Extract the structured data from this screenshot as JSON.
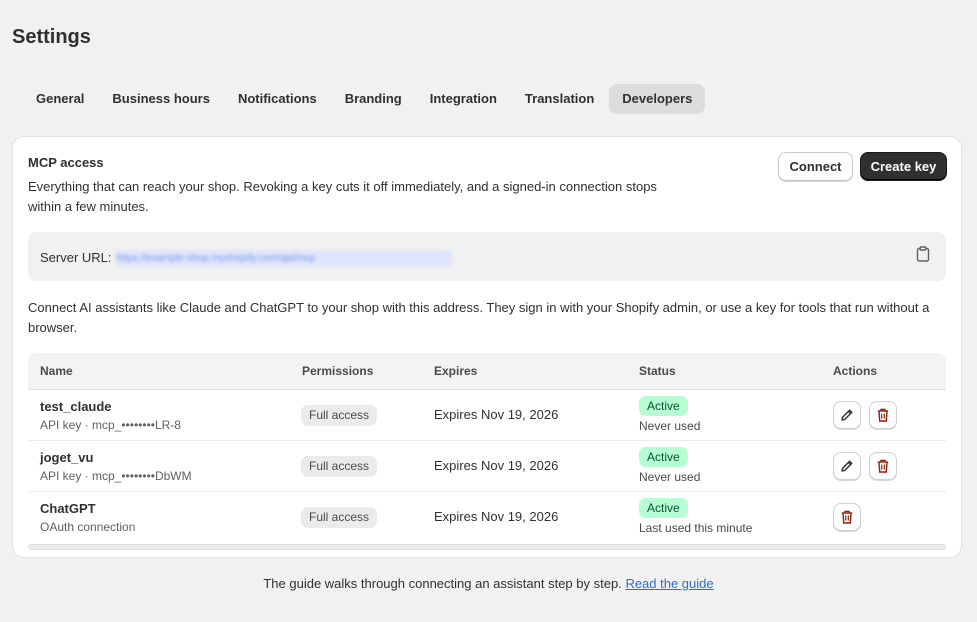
{
  "page": {
    "title": "Settings"
  },
  "tabs": [
    {
      "label": "General"
    },
    {
      "label": "Business hours"
    },
    {
      "label": "Notifications"
    },
    {
      "label": "Branding"
    },
    {
      "label": "Integration"
    },
    {
      "label": "Translation"
    },
    {
      "label": "Developers",
      "active": true
    }
  ],
  "mcp": {
    "title": "MCP access",
    "description": "Everything that can reach your shop. Revoking a key cuts it off immediately, and a signed-in connection stops within a few minutes.",
    "connect_label": "Connect",
    "create_key_label": "Create key",
    "server_url_label": "Server URL:",
    "server_url_value": "https://example-shop.myshopify.com/api/mcp",
    "help_text": "Connect AI assistants like Claude and ChatGPT to your shop with this address. They sign in with your Shopify admin, or use a key for tools that run without a browser."
  },
  "table": {
    "columns": [
      "Name",
      "Permissions",
      "Expires",
      "Status",
      "Actions"
    ],
    "rows": [
      {
        "name": "test_claude",
        "sub": "API key · mcp_••••••••LR-8",
        "permission": "Full access",
        "expires": "Expires Nov 19, 2026",
        "status": "Active",
        "status_sub": "Never used",
        "editable": true
      },
      {
        "name": "joget_vu",
        "sub": "API key · mcp_••••••••DbWM",
        "permission": "Full access",
        "expires": "Expires Nov 19, 2026",
        "status": "Active",
        "status_sub": "Never used",
        "editable": true
      },
      {
        "name": "ChatGPT",
        "sub": "OAuth connection",
        "permission": "Full access",
        "expires": "Expires Nov 19, 2026",
        "status": "Active",
        "status_sub": "Last used this minute",
        "editable": false
      }
    ]
  },
  "footer": {
    "text": "The guide walks through connecting an assistant step by step.",
    "link_label": "Read the guide"
  },
  "colors": {
    "status_bg": "#b4fed2",
    "status_text": "#0c5132",
    "delete_icon": "#8e1f0b",
    "primary_button": "#303030",
    "link": "#2c6ecb"
  },
  "icons": {
    "copy": "clipboard-icon",
    "edit": "pencil-icon",
    "delete": "trash-icon"
  }
}
